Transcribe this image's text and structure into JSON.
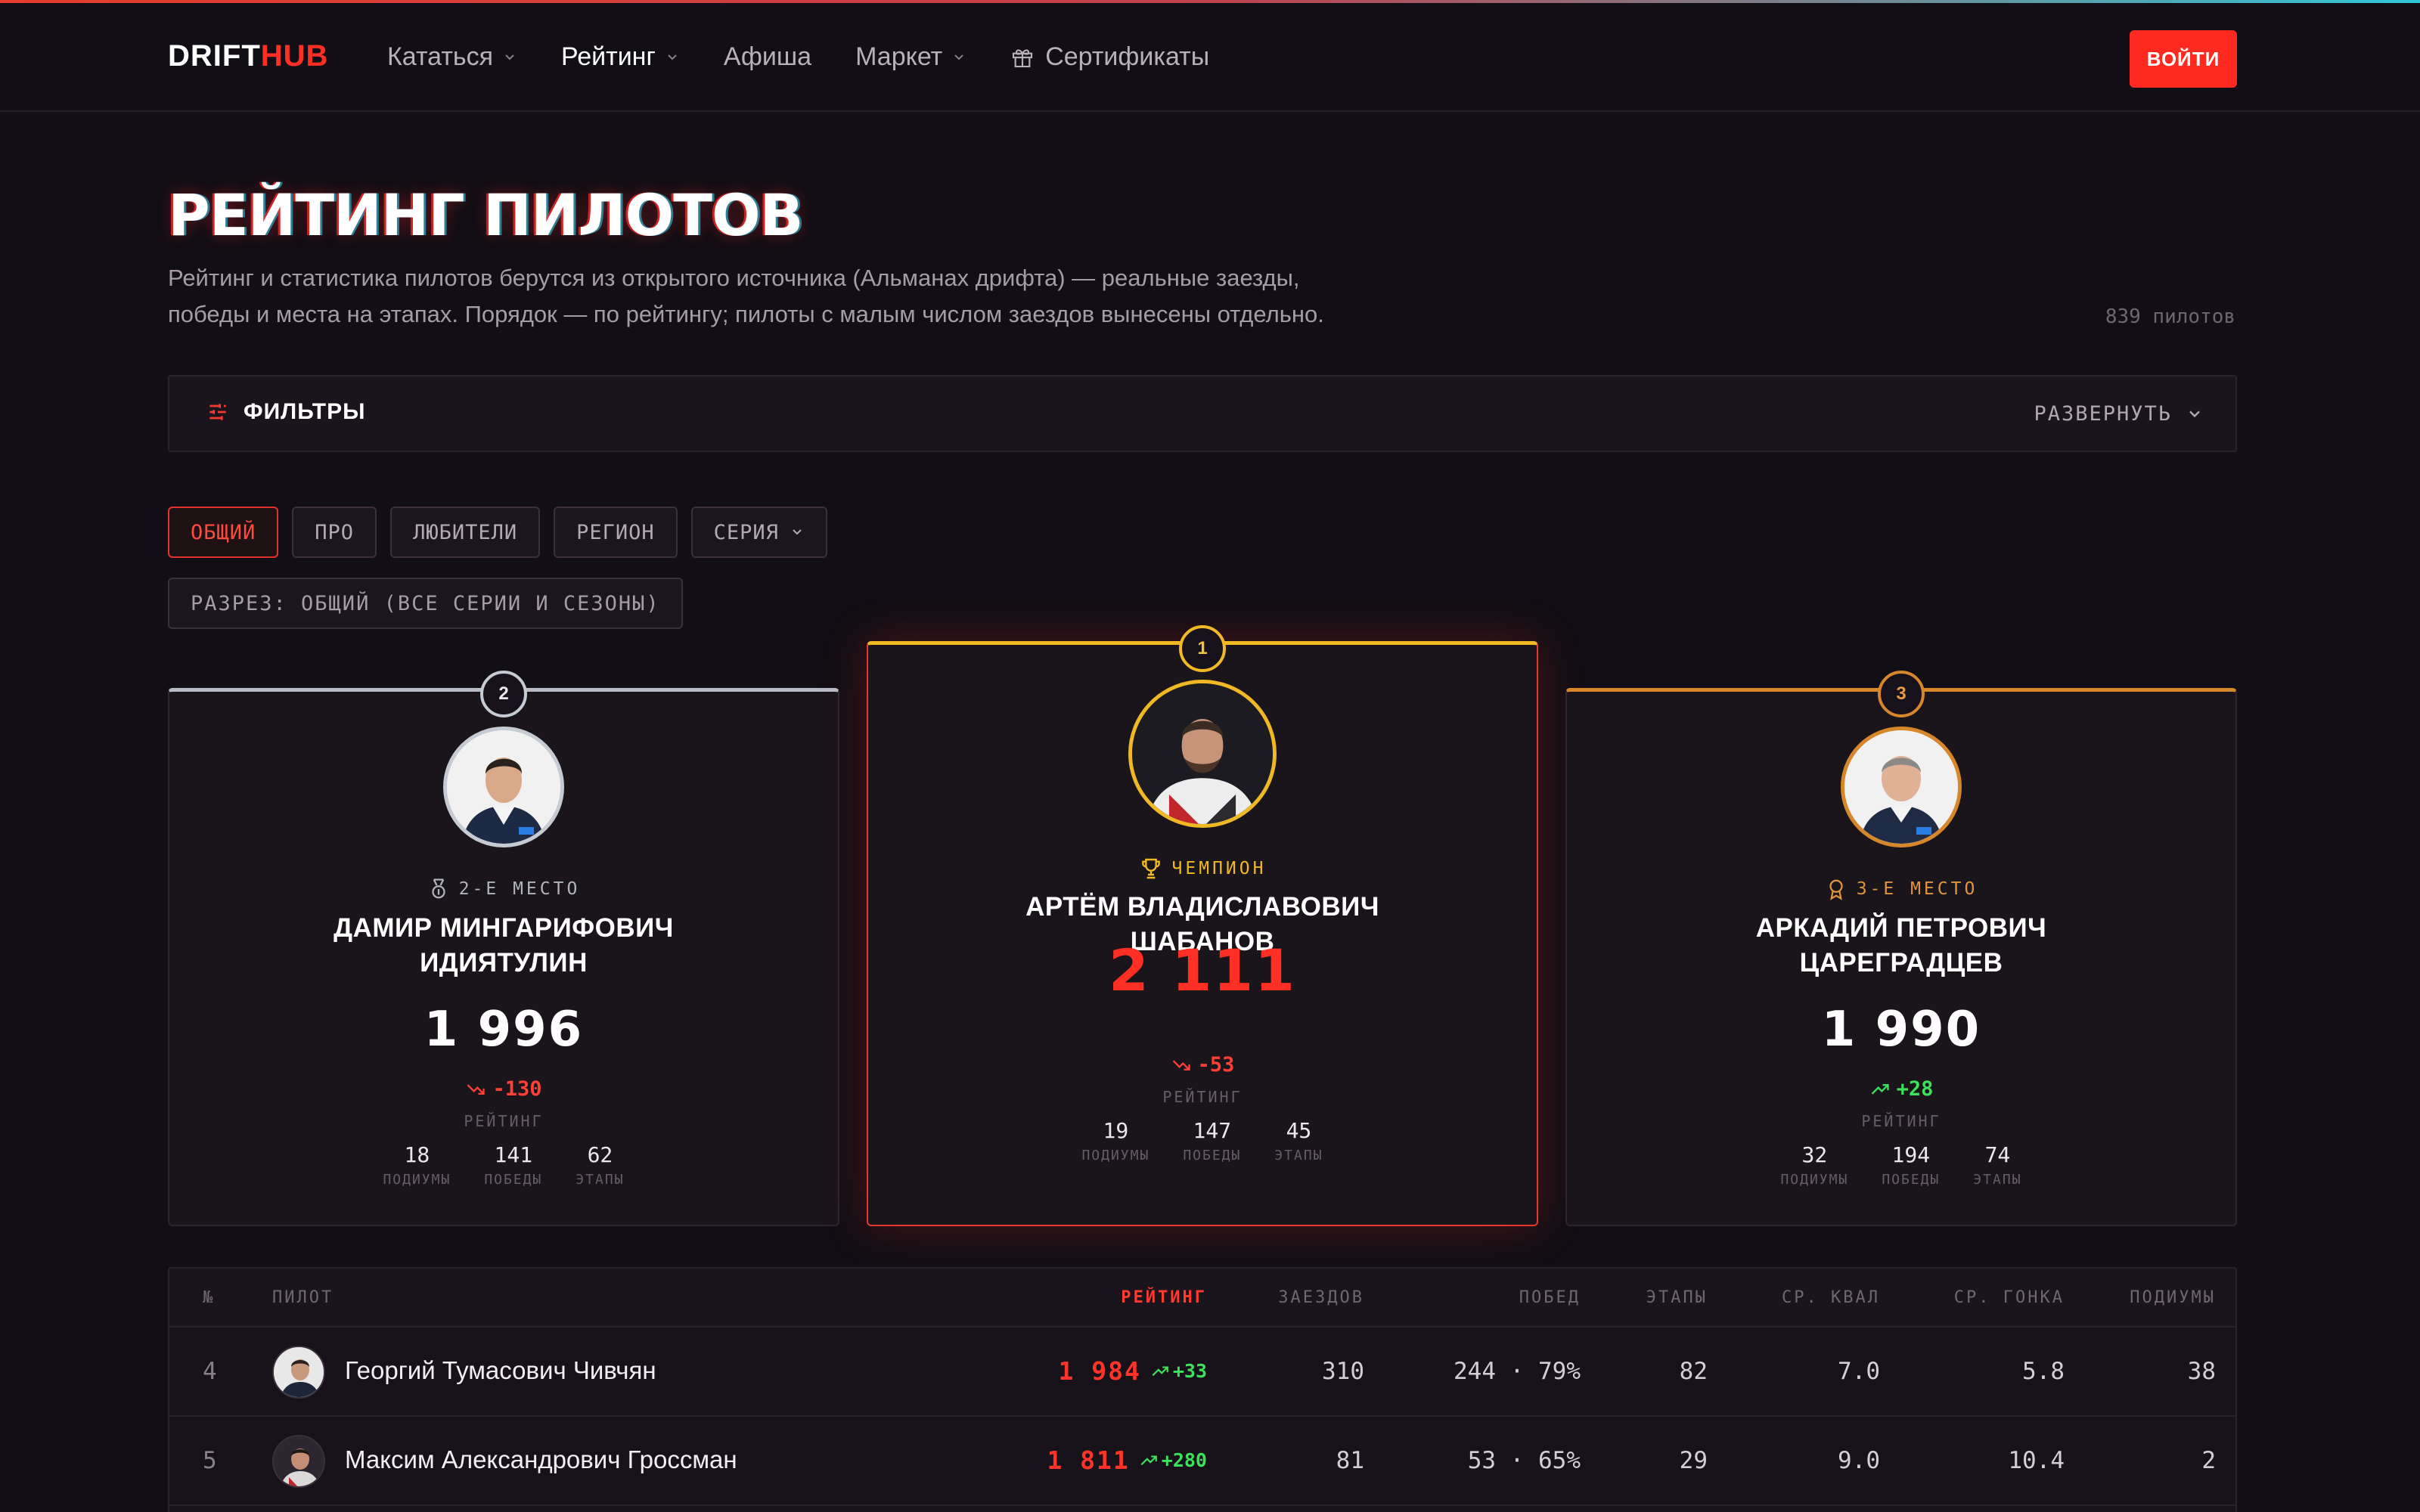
{
  "header": {
    "logo_a": "DRIFT",
    "logo_b": "HUB",
    "nav": [
      {
        "label": "Кататься",
        "dropdown": true
      },
      {
        "label": "Рейтинг",
        "dropdown": true,
        "active": true
      },
      {
        "label": "Афиша",
        "dropdown": false
      },
      {
        "label": "Маркет",
        "dropdown": true
      },
      {
        "label": "Сертификаты",
        "icon": "gift-icon"
      }
    ],
    "login_label": "ВОЙТИ"
  },
  "page": {
    "title": "РЕЙТИНГ ПИЛОТОВ",
    "desc_line1": "Рейтинг и статистика пилотов берутся из открытого источника (Альманах дрифта) — реальные заезды,",
    "desc_line2": "победы и места на этапах. Порядок — по рейтингу; пилоты с малым числом заездов вынесены отдельно.",
    "count": "839 пилотов"
  },
  "filters": {
    "label": "ФИЛЬТРЫ",
    "expand_label": "РАЗВЕРНУТЬ",
    "chips": [
      {
        "label": "ОБЩИЙ",
        "active": true
      },
      {
        "label": "ПРО"
      },
      {
        "label": "ЛЮБИТЕЛИ"
      },
      {
        "label": "РЕГИОН"
      },
      {
        "label": "СЕРИЯ",
        "dropdown": true
      }
    ],
    "slice": "РАЗРЕЗ: ОБЩИЙ (ВСЕ СЕРИИ И СЕЗОНЫ)"
  },
  "podium": {
    "second": {
      "place": "2",
      "label": "2-Е МЕСТО",
      "name_1": "ДАМИР МИНГАРИФОВИЧ",
      "name_2": "ИДИЯТУЛИН",
      "rating": "1 996",
      "delta": "-130",
      "rating_cap": "РЕЙТИНГ",
      "stats": [
        {
          "value": "18",
          "label": "ПОДИУМЫ"
        },
        {
          "value": "141",
          "label": "ПОБЕДЫ"
        },
        {
          "value": "62",
          "label": "ЭТАПЫ"
        }
      ]
    },
    "first": {
      "place": "1",
      "label": "ЧЕМПИОН",
      "name_1": "АРТЁМ ВЛАДИСЛАВОВИЧ",
      "name_2": "ШАБАНОВ",
      "rating": "2 111",
      "delta": "-53",
      "rating_cap": "РЕЙТИНГ",
      "stats": [
        {
          "value": "19",
          "label": "ПОДИУМЫ"
        },
        {
          "value": "147",
          "label": "ПОБЕДЫ"
        },
        {
          "value": "45",
          "label": "ЭТАПЫ"
        }
      ]
    },
    "third": {
      "place": "3",
      "label": "3-Е МЕСТО",
      "name_1": "АРКАДИЙ ПЕТРОВИЧ",
      "name_2": "ЦАРЕГРАДЦЕВ",
      "rating": "1 990",
      "delta": "+28",
      "rating_cap": "РЕЙТИНГ",
      "stats": [
        {
          "value": "32",
          "label": "ПОДИУМЫ"
        },
        {
          "value": "194",
          "label": "ПОБЕДЫ"
        },
        {
          "value": "74",
          "label": "ЭТАПЫ"
        }
      ]
    }
  },
  "table": {
    "headers": {
      "num": "№",
      "pilot": "ПИЛОТ",
      "rating": "РЕЙТИНГ",
      "runs": "ЗАЕЗДОВ",
      "wins": "ПОБЕД",
      "stages": "ЭТАПЫ",
      "avg_qual": "СР. КВАЛ",
      "avg_race": "СР. ГОНКА",
      "podiums": "ПОДИУМЫ"
    },
    "rows": [
      {
        "rank": "4",
        "name": "Георгий Тумасович Чивчян",
        "rating": "1 984",
        "delta": "+33",
        "runs": "310",
        "wins": "244 · 79%",
        "stages": "82",
        "avg_qual": "7.0",
        "avg_race": "5.8",
        "podiums": "38"
      },
      {
        "rank": "5",
        "name": "Максим Александрович Гроссман",
        "rating": "1 811",
        "delta": "+280",
        "runs": "81",
        "wins": "53 · 65%",
        "stages": "29",
        "avg_qual": "9.0",
        "avg_race": "10.4",
        "podiums": "2"
      }
    ]
  },
  "colors": {
    "accent": "#ff2f24",
    "gold": "#f0b823",
    "silver": "#c6cad2",
    "bronze": "#d8862a",
    "up": "#3ce25a",
    "down": "#ff4036"
  }
}
